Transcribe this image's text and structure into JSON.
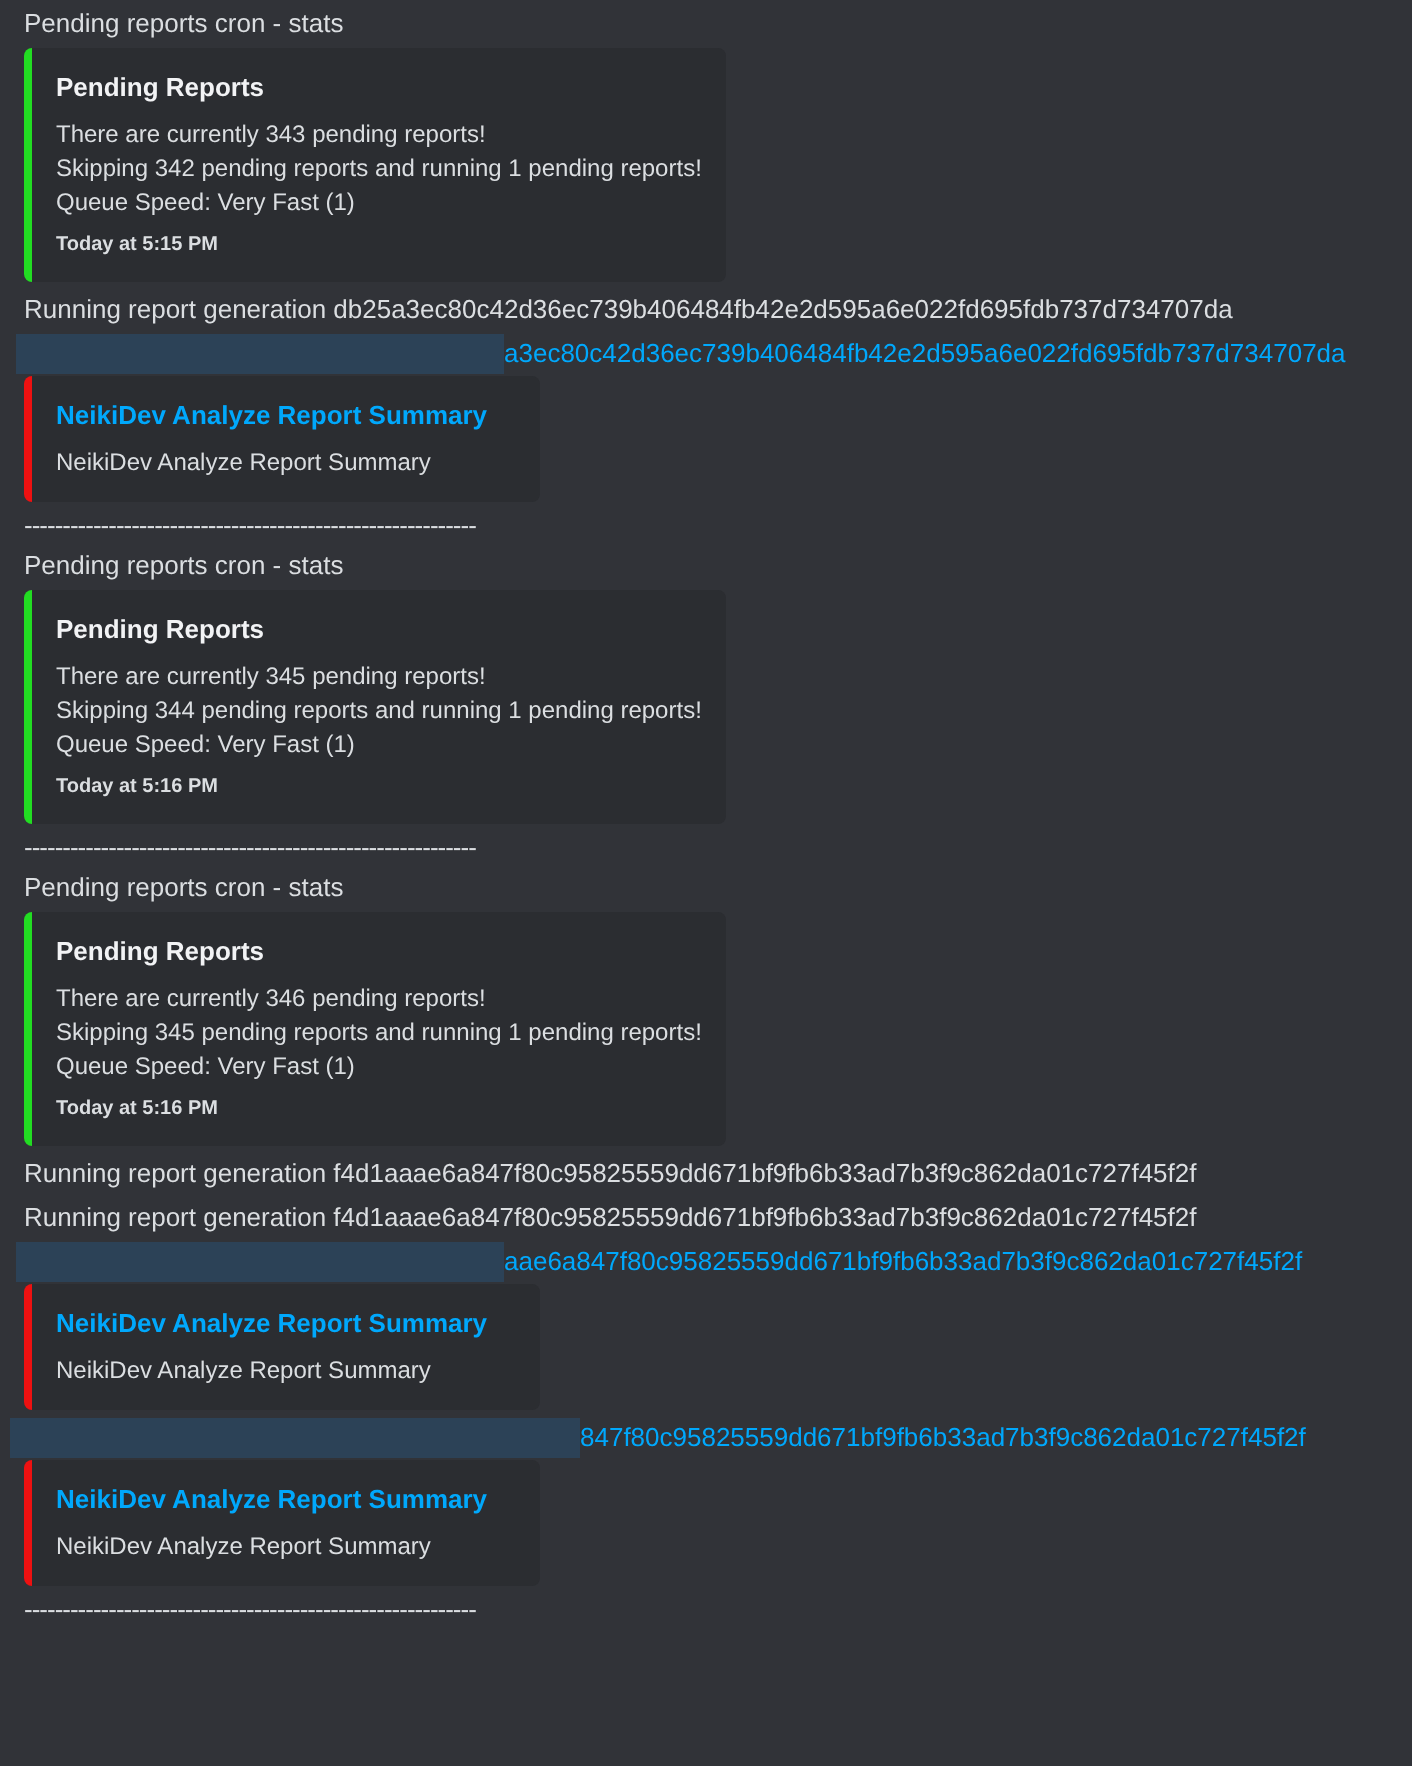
{
  "messages": [
    {
      "kind": "text",
      "text": "Pending reports cron - stats"
    },
    {
      "kind": "embed",
      "color": "#22dd22",
      "title": "Pending Reports",
      "title_link": false,
      "lines": [
        "There are currently 343 pending reports!",
        "Skipping 342 pending reports and running 1 pending reports!",
        "Queue Speed: Very Fast (1)"
      ],
      "footer": "Today at 5:15 PM"
    },
    {
      "kind": "text",
      "text": "Running report generation db25a3ec80c42d36ec739b406484fb42e2d595a6e022fd695fdb737d734707da"
    },
    {
      "kind": "link",
      "text": "a3ec80c42d36ec739b406484fb42e2d595a6e022fd695fdb737d734707da"
    },
    {
      "kind": "embed",
      "color": "#ee1111",
      "title": "NeikiDev Analyze Report Summary",
      "title_link": true,
      "lines": [
        "NeikiDev Analyze Report Summary"
      ]
    },
    {
      "kind": "divider",
      "text": "-----------------------------------------------------------"
    },
    {
      "kind": "text",
      "text": "Pending reports cron - stats"
    },
    {
      "kind": "embed",
      "color": "#22dd22",
      "title": "Pending Reports",
      "title_link": false,
      "lines": [
        "There are currently 345 pending reports!",
        "Skipping 344 pending reports and running 1 pending reports!",
        "Queue Speed: Very Fast (1)"
      ],
      "footer": "Today at 5:16 PM"
    },
    {
      "kind": "divider",
      "text": "-----------------------------------------------------------"
    },
    {
      "kind": "text",
      "text": "Pending reports cron - stats"
    },
    {
      "kind": "embed",
      "color": "#22dd22",
      "title": "Pending Reports",
      "title_link": false,
      "lines": [
        "There are currently 346 pending reports!",
        "Skipping 345 pending reports and running 1 pending reports!",
        "Queue Speed: Very Fast (1)"
      ],
      "footer": "Today at 5:16 PM"
    },
    {
      "kind": "text",
      "text": "Running report generation f4d1aaae6a847f80c95825559dd671bf9fb6b33ad7b3f9c862da01c727f45f2f"
    },
    {
      "kind": "text",
      "text": "Running report generation f4d1aaae6a847f80c95825559dd671bf9fb6b33ad7b3f9c862da01c727f45f2f"
    },
    {
      "kind": "link",
      "text": "aae6a847f80c95825559dd671bf9fb6b33ad7b3f9c862da01c727f45f2f"
    },
    {
      "kind": "embed",
      "color": "#ee1111",
      "title": "NeikiDev Analyze Report Summary",
      "title_link": true,
      "lines": [
        "NeikiDev Analyze Report Summary"
      ]
    },
    {
      "kind": "link",
      "text": "847f80c95825559dd671bf9fb6b33ad7b3f9c862da01c727f45f2f",
      "wide_redaction": true
    },
    {
      "kind": "embed",
      "color": "#ee1111",
      "title": "NeikiDev Analyze Report Summary",
      "title_link": true,
      "lines": [
        "NeikiDev Analyze Report Summary"
      ]
    },
    {
      "kind": "divider",
      "text": "-----------------------------------------------------------"
    }
  ]
}
